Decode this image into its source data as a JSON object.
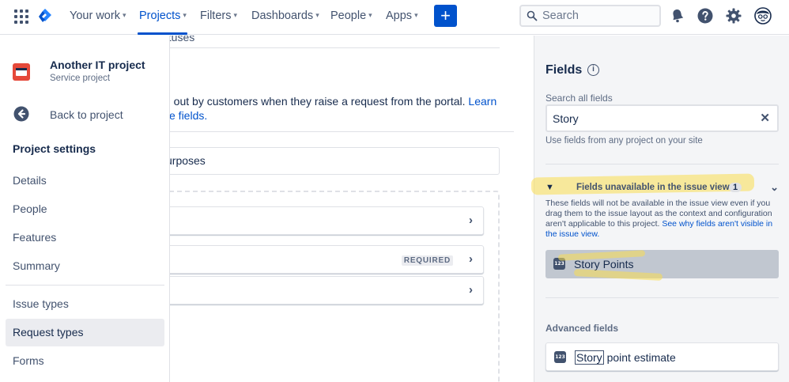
{
  "topnav": {
    "items": [
      {
        "label": "Your work",
        "chevron": "▾"
      },
      {
        "label": "Projects",
        "chevron": "▾"
      },
      {
        "label": "Filters",
        "chevron": "▾"
      },
      {
        "label": "Dashboards",
        "chevron": "▾"
      },
      {
        "label": "People",
        "chevron": "▾"
      },
      {
        "label": "Apps",
        "chevron": "▾"
      }
    ],
    "active_item": "Projects",
    "create_label": "+",
    "search_placeholder": "Search",
    "icons": [
      "app-switcher-icon",
      "jira-logo-icon",
      "search-icon",
      "notification-bell-icon",
      "help-icon",
      "settings-gear-icon",
      "user-avatar-icon"
    ],
    "accent_color": "#0052CC"
  },
  "sidebar": {
    "project_name": "Another IT project",
    "project_type": "Service project",
    "back_label": "Back to project",
    "heading": "Project settings",
    "items": [
      {
        "label": "Details"
      },
      {
        "label": "People"
      },
      {
        "label": "Features"
      },
      {
        "label": "Summary"
      },
      {
        "label": "Issue types"
      },
      {
        "label": "Request types"
      },
      {
        "label": "Forms"
      }
    ],
    "selected": "Request types"
  },
  "main": {
    "partial_tab": "atuses",
    "desc_line1": "d out by customers when they raise a request from the portal.",
    "desc_link1": "Learn",
    "desc_line2": "ze fields.",
    "purpose_text": "urposes",
    "rows": [
      {
        "required": ""
      },
      {
        "required": "REQUIRED"
      },
      {
        "required": ""
      }
    ],
    "chevron": "›"
  },
  "rpanel": {
    "title": "Fields",
    "info_glyph": "i",
    "search_label": "Search all fields",
    "search_value": "Story",
    "clear_glyph": "✕",
    "hint": "Use fields from any project on your site",
    "unavailable": {
      "toggle": "▼",
      "label": "Fields unavailable in the issue view",
      "count": "1",
      "collapse": "⌄",
      "note": "These fields will not be available in the issue view even if you drag them to the issue layout as the context and configuration aren't applicable to this project.",
      "note_link": "See why fields aren't visible in the issue view."
    },
    "unavailable_field": {
      "name": "Story Points",
      "icon": "number-field-icon"
    },
    "advanced_heading": "Advanced fields",
    "advanced_field": {
      "match": "Story",
      "rest": " point estimate",
      "icon": "number-field-icon"
    },
    "number_icon_text": "123",
    "highlight_color": "#FADC50"
  }
}
